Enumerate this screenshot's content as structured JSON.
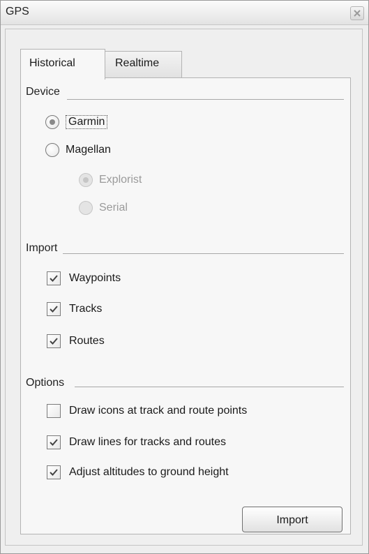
{
  "window": {
    "title": "GPS"
  },
  "tabs": [
    {
      "label": "Historical",
      "selected": true
    },
    {
      "label": "Realtime",
      "selected": false
    }
  ],
  "device": {
    "section_label": "Device",
    "options": [
      {
        "label": "Garmin",
        "selected": true,
        "enabled": true
      },
      {
        "label": "Magellan",
        "selected": false,
        "enabled": true
      }
    ],
    "magellan_sub": [
      {
        "label": "Explorist",
        "selected": true,
        "enabled": false
      },
      {
        "label": "Serial",
        "selected": false,
        "enabled": false
      }
    ]
  },
  "import": {
    "section_label": "Import",
    "items": [
      {
        "label": "Waypoints",
        "checked": true
      },
      {
        "label": "Tracks",
        "checked": true
      },
      {
        "label": "Routes",
        "checked": true
      }
    ]
  },
  "options": {
    "section_label": "Options",
    "items": [
      {
        "label": "Draw icons at track and route points",
        "checked": false
      },
      {
        "label": "Draw lines for tracks and routes",
        "checked": true
      },
      {
        "label": "Adjust altitudes to ground height",
        "checked": true
      }
    ]
  },
  "actions": {
    "import_label": "Import"
  },
  "icons": {
    "close": "close-icon",
    "check": "checkmark-icon"
  },
  "colors": {
    "window_bg": "#eeeeee",
    "panel_bg": "#f7f7f7",
    "border": "#b3b3b3"
  }
}
